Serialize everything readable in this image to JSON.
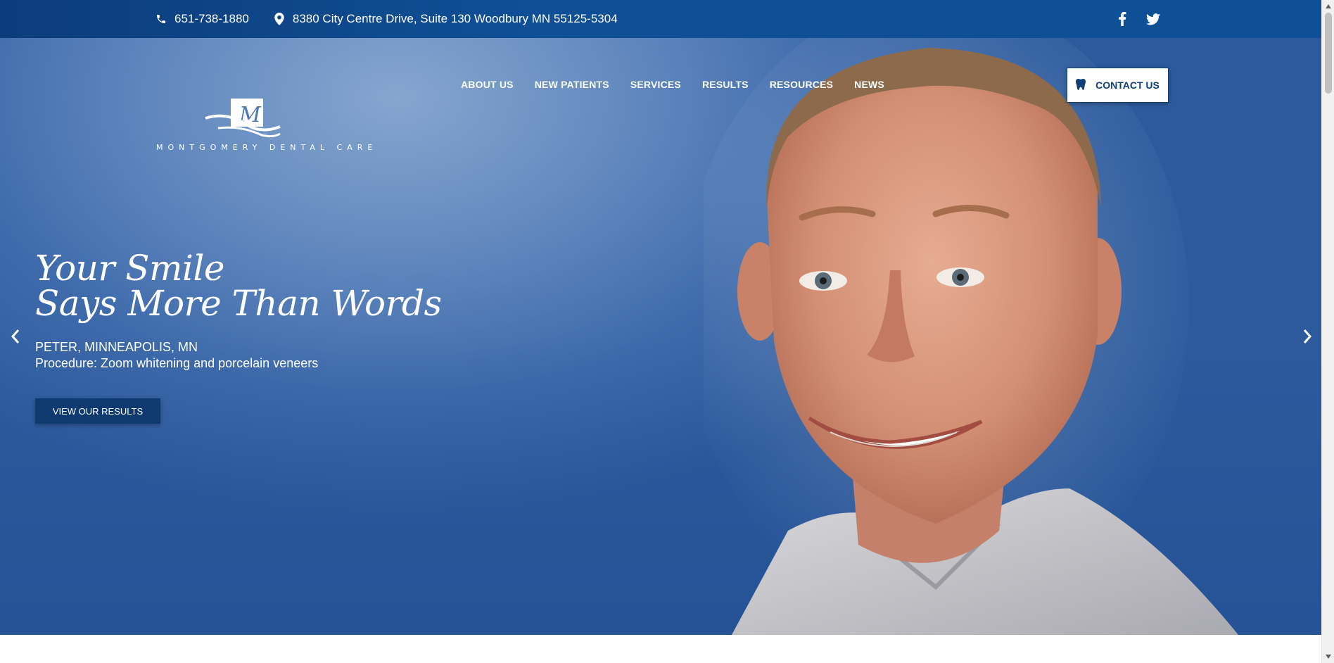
{
  "topbar": {
    "phone": "651-738-1880",
    "address": "8380 City Centre Drive, Suite 130 Woodbury MN 55125-5304",
    "phone_icon": "phone-icon",
    "location_icon": "map-pin-icon",
    "social": [
      "facebook-icon",
      "twitter-icon"
    ]
  },
  "logo": {
    "mark": "M",
    "wordmark": "MONTGOMERY DENTAL CARE"
  },
  "nav": {
    "items": [
      {
        "label": "ABOUT US"
      },
      {
        "label": "NEW PATIENTS"
      },
      {
        "label": "SERVICES"
      },
      {
        "label": "RESULTS"
      },
      {
        "label": "RESOURCES"
      },
      {
        "label": "NEWS"
      }
    ],
    "contact_label": "CONTACT US",
    "contact_icon": "tooth-icon"
  },
  "hero": {
    "headline_line1": "Your Smile",
    "headline_line2": "Says More Than Words",
    "patient": "PETER, MINNEAPOLIS, MN",
    "procedure": "Procedure: Zoom whitening and porcelain veneers",
    "cta_label": "VIEW OUR RESULTS",
    "prev_icon": "chevron-left-icon",
    "next_icon": "chevron-right-icon"
  },
  "colors": {
    "topbar": "#0f4f95",
    "hero_bg": "#5f86bd",
    "button_dark": "#0f3a70",
    "white": "#ffffff"
  }
}
